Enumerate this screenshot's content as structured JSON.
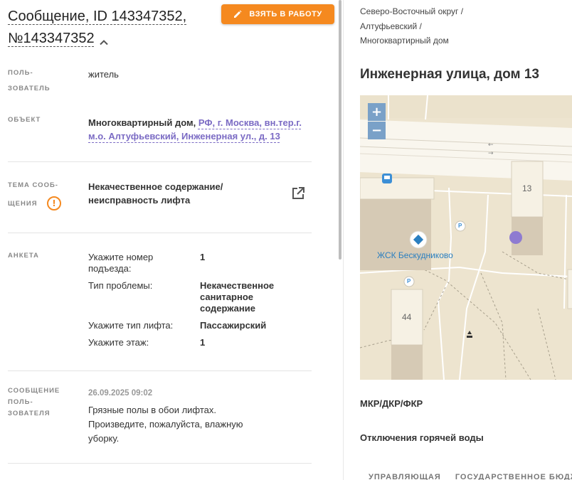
{
  "message": {
    "title_line1": "Сообщение, ID 143347352,",
    "title_line2": "№143347352",
    "take_button": "ВЗЯТЬ В РАБОТУ"
  },
  "fields": {
    "user": {
      "label1": "ПОЛЬ-",
      "label2": "ЗОВАТЕЛЬ",
      "value": "житель"
    },
    "object": {
      "label": "ОБЪЕКТ",
      "type": "Многоквартирный дом,",
      "address_line1": "РФ, г. Москва, вн.тер.г.",
      "address_line2": "м.о. Алтуфьевский, Инженерная ул., д. 13"
    },
    "topic": {
      "label1": "ТЕМА СООБ-",
      "label2": "ЩЕНИЯ",
      "value_line1": "Некачественное содержание/",
      "value_line2": "неисправность лифта"
    },
    "survey": {
      "label": "АНКЕТА",
      "rows": [
        {
          "q": "Укажите номер подъезда:",
          "a": "1"
        },
        {
          "q": "Тип проблемы:",
          "a": "Некачественное санитарное содержание"
        },
        {
          "q": "Укажите тип лифта:",
          "a": "Пассажирский"
        },
        {
          "q": "Укажите этаж:",
          "a": "1"
        }
      ]
    },
    "user_message": {
      "label1": "СООБЩЕНИЕ",
      "label2": "ПОЛЬ-",
      "label3": "ЗОВАТЕЛЯ",
      "date": "26.09.2025 09:02",
      "text": "Грязные полы в обои лифтах. Произведите, пожалуйста, влажную уборку."
    }
  },
  "right_panel": {
    "breadcrumbs": [
      "Северо-Восточный округ /",
      "Алтуфьевский /",
      "Многоквартирный дом"
    ],
    "address": "Инженерная улица, дом 13",
    "map": {
      "zoom_in": "+",
      "zoom_out": "−",
      "building_13": "13",
      "building_44": "44",
      "poi_label": "ЖСК Бескудниково",
      "parking": "P",
      "colors": {
        "poi": "#2a7fc0",
        "marker": "#8e7bd1",
        "building": "#f6f1e4"
      }
    },
    "section_1": "МКР/ДКР/ФКР",
    "section_2": "Отключения горячей воды",
    "tabs": [
      "УПРАВЛЯЮЩАЯ",
      "ГОСУДАРСТВЕННОЕ БЮДЖ"
    ]
  }
}
